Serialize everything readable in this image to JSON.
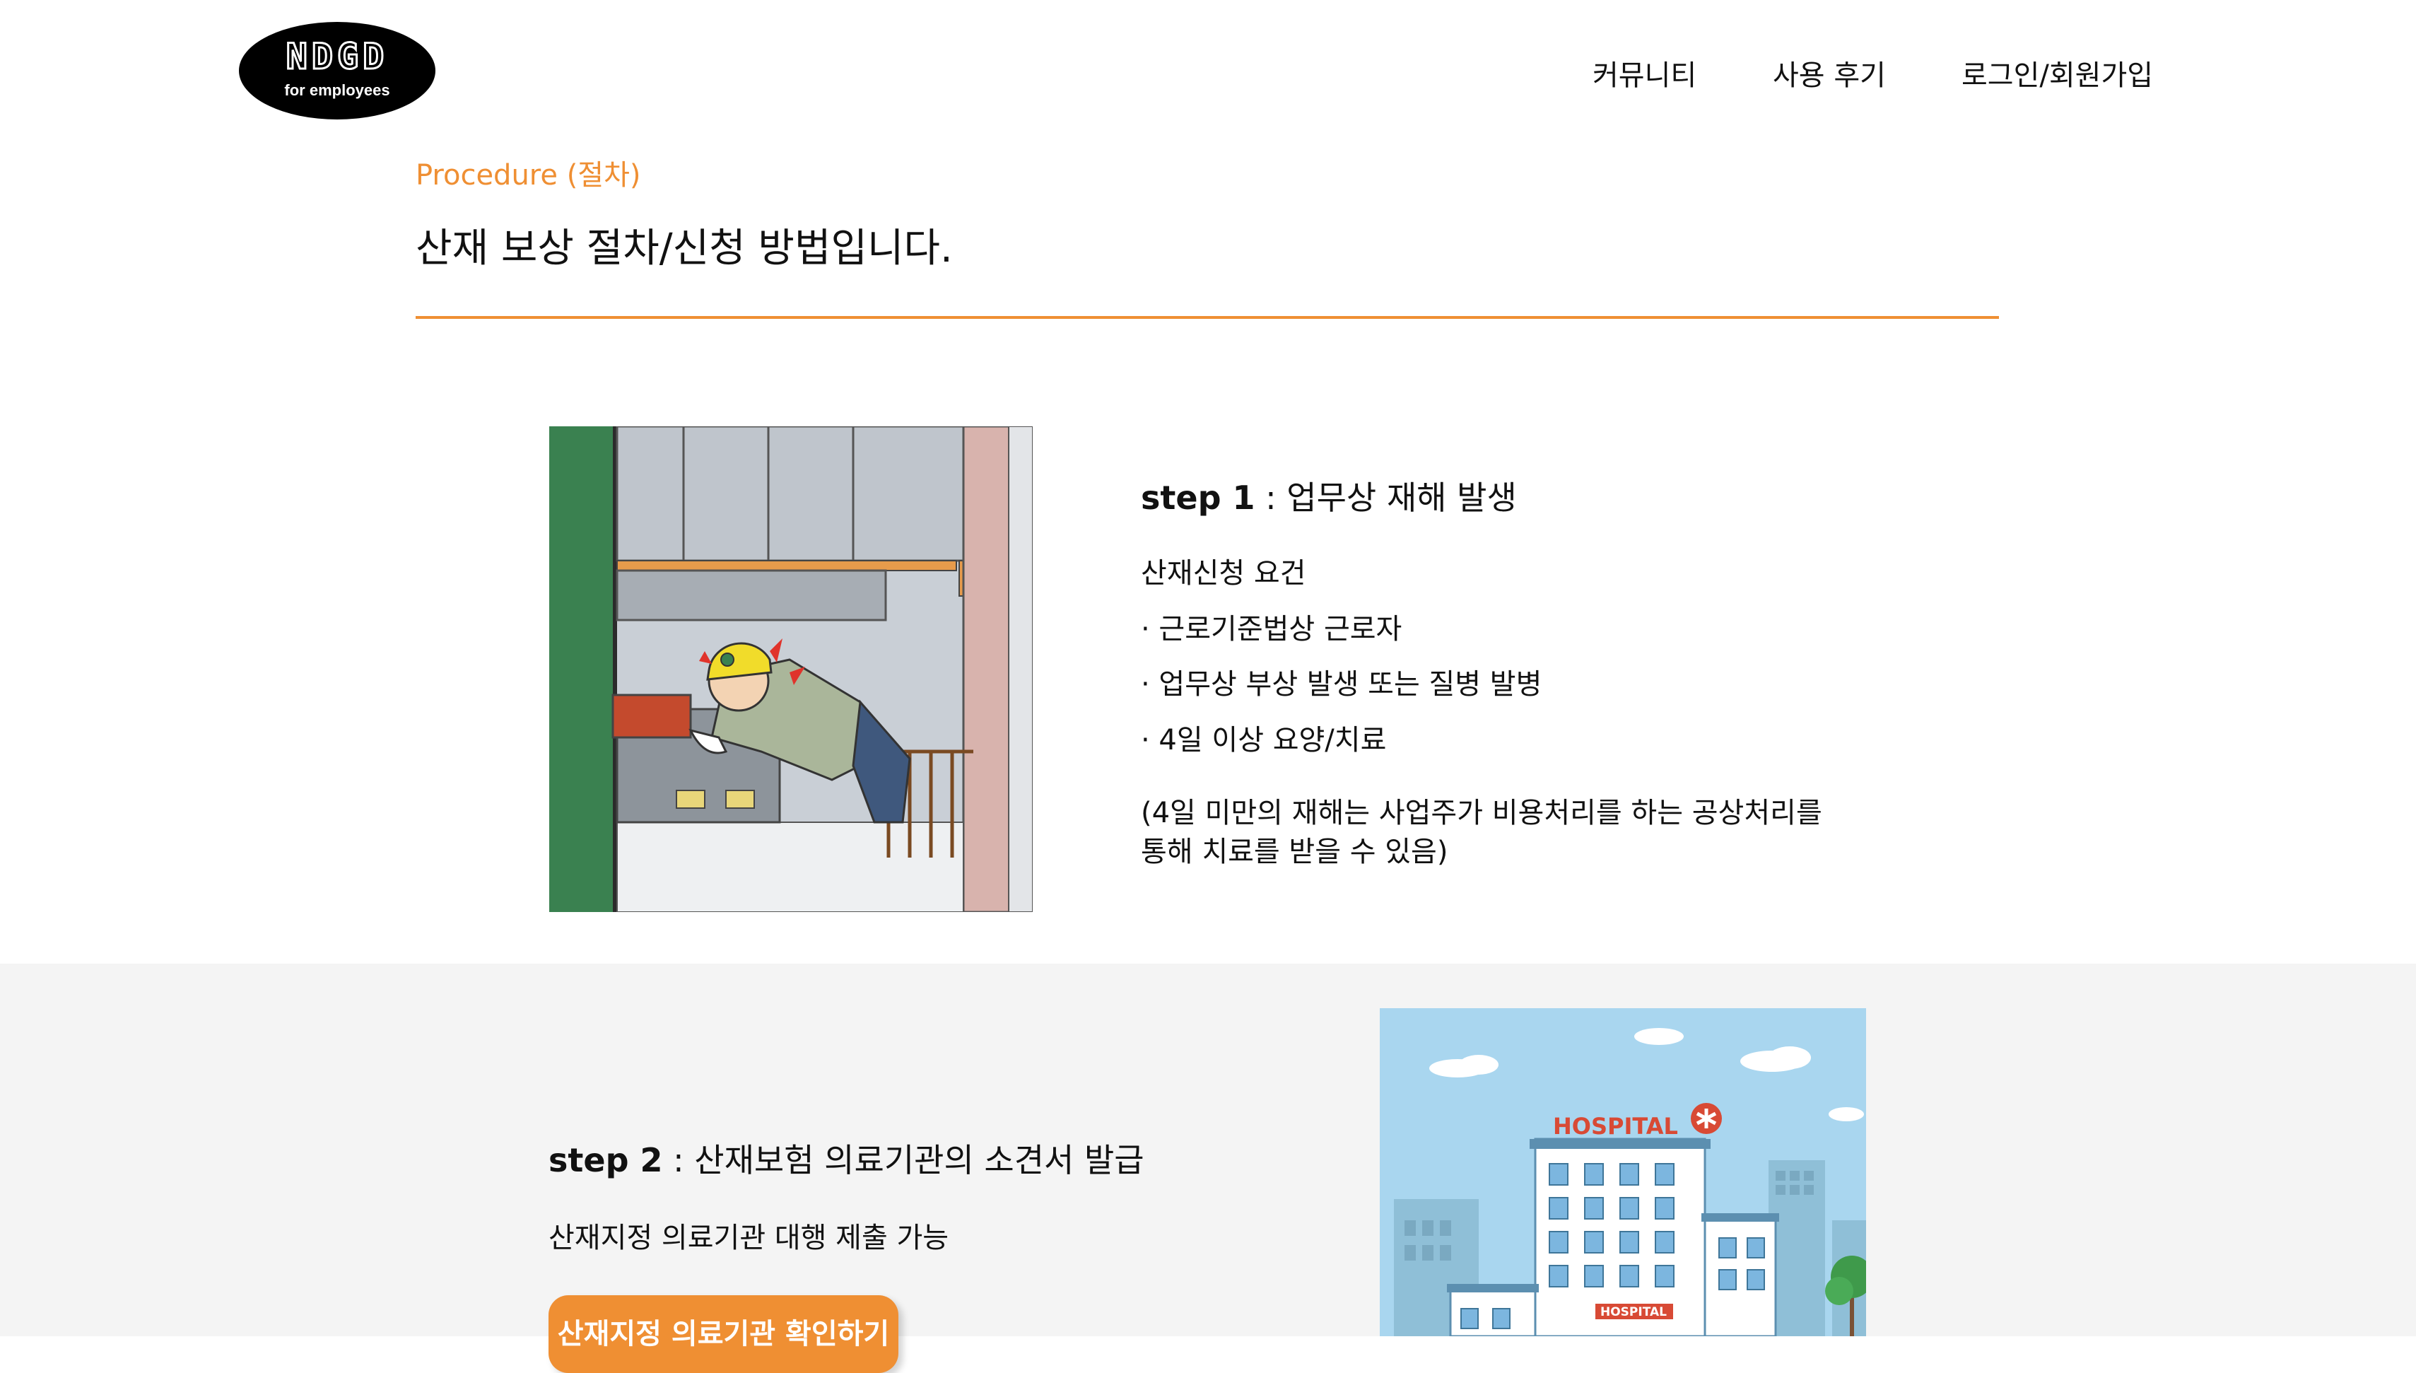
{
  "header": {
    "logo": {
      "main": "NDGD",
      "sub": "for employees"
    },
    "nav": [
      "커뮤니티",
      "사용 후기",
      "로그인/회원가입"
    ]
  },
  "procedure": {
    "eyebrow": "Procedure (절차)",
    "title": "산재 보상 절차/신청 방법입니다."
  },
  "step1": {
    "label": "step 1",
    "title": " : 업무상 재해 발생",
    "requirements_title": "산재신청 요건",
    "requirements": [
      "· 근로기준법상 근로자",
      "· 업무상 부상 발생 또는 질병 발병",
      "· 4일 이상 요양/치료"
    ],
    "note": [
      "(4일 미만의 재해는 사업주가 비용처리를 하는 공상처리를",
      "통해 치료를 받을 수 있음)"
    ]
  },
  "step2": {
    "label": "step 2",
    "title": " : 산재보험 의료기관의 소견서 발급",
    "desc": "산재지정 의료기관 대행 제출 가능",
    "button": "산재지정 의료기관 확인하기",
    "image_sign_large": "HOSPITAL",
    "image_sign_small": "HOSPITAL"
  },
  "colors": {
    "accent": "#ef8f33",
    "band_bg": "#f4f4f4"
  }
}
